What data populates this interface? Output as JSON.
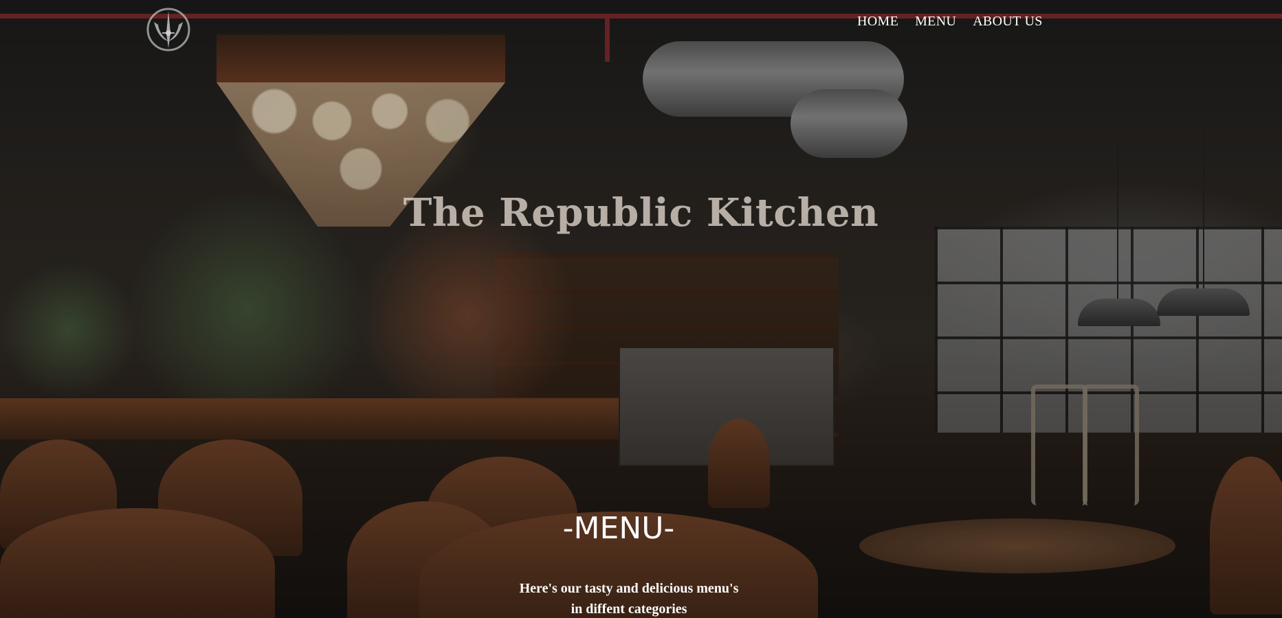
{
  "header": {
    "logo_icon": "starbird-emblem-icon",
    "nav": [
      {
        "label": "HOME"
      },
      {
        "label": "MENU"
      },
      {
        "label": "ABOUT US"
      }
    ]
  },
  "hero": {
    "title": "The Republic Kitchen",
    "background": "restaurant-interior-photo"
  },
  "menu_section": {
    "heading": "-MENU-",
    "description_line1": "Here's our tasty and delicious menu's",
    "description_line2": "in diffent categories"
  },
  "colors": {
    "text": "#ffffff",
    "title": "#e1d7cd"
  }
}
